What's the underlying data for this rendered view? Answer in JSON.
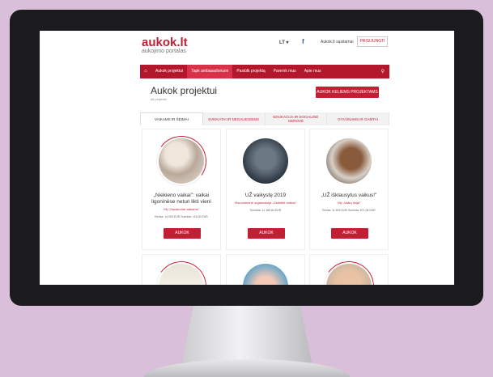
{
  "header": {
    "logo": "aukok.lt",
    "tagline": "aukojimo portalas",
    "lang": "LT ▾",
    "fb_icon": "f",
    "link": "Aukok.lt sąsitarnai",
    "login": "PRISIJUNGTI"
  },
  "nav": {
    "items": [
      "Aukok projektui",
      "Tapk ambasadoriumi",
      "Pasiūlk projektą",
      "Paremk mus",
      "Apie mus"
    ]
  },
  "page": {
    "title": "Aukok projektui",
    "crumb": "All projects",
    "cta": "AUKOK KELIEMS PROJEKTAMS"
  },
  "tabs": [
    "VAIKAMS IR ŠEIMAI",
    "SVEIKATAI IR NEGALIESIEMS",
    "EDUKACIJA IR SOCIALINĖ GEROVĖ",
    "GYVŪNAMS IR GAMTAI"
  ],
  "cards": [
    {
      "title": "„Niekieno vaikai\": vaikai ligoninėse neturi likti vieni",
      "org": "VšĮ „Savanoriai vaikams\"",
      "stats": "Remia: 14 000 EUR    Surinkta: 118,00 EUR",
      "button": "AUKOK"
    },
    {
      "title": "UŽ vaikystę 2019",
      "org": "Visuomeninė organizacija „Gelbėkit vaikus\"",
      "stats": "Surinkta: 11 180,84 EUR",
      "button": "AUKOK"
    },
    {
      "title": "„UŽ išklausytus vaikus!\"",
      "org": "VšĮ „Vaikų linija\"",
      "stats": "Remia: 11 800 EUR    Surinkta: 871,06 EUR",
      "button": "AUKOK"
    }
  ]
}
